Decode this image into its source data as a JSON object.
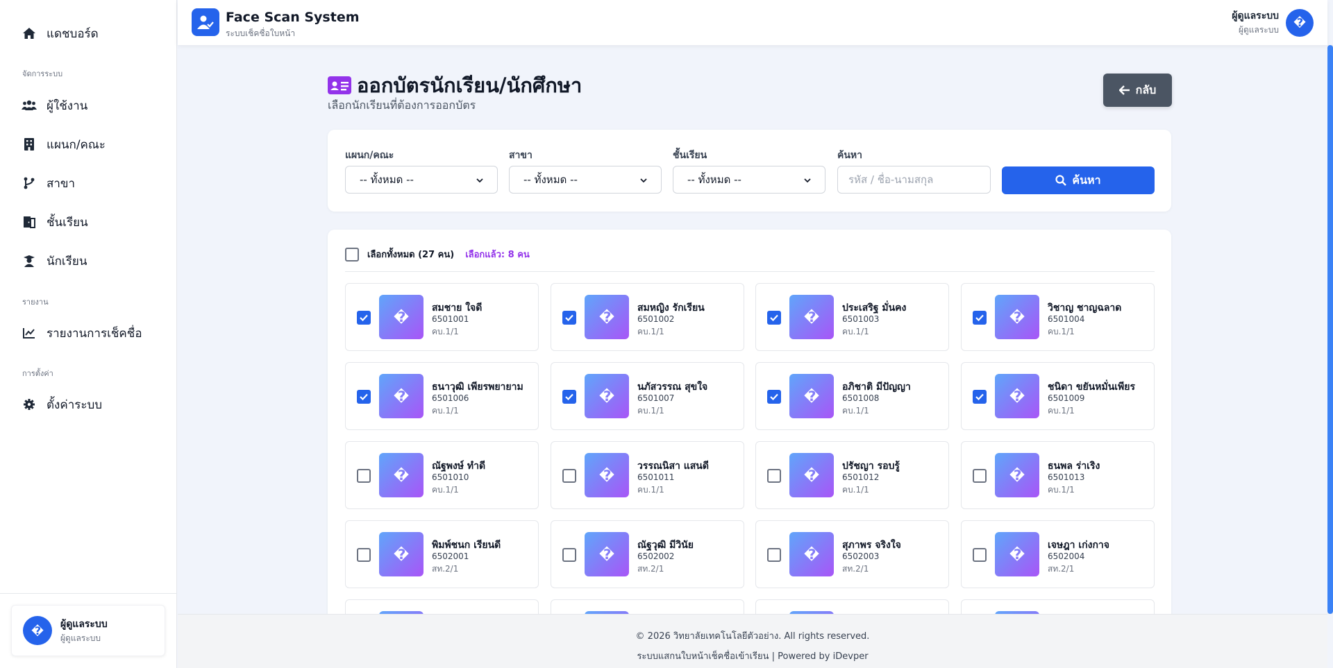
{
  "app": {
    "title": "Face Scan System",
    "subtitle": "ระบบเช็คชื่อใบหน้า",
    "brand_color": "#2563eb"
  },
  "sidebar": {
    "dashboard": "แดชบอร์ด",
    "section_manage": "จัดการระบบ",
    "users": "ผู้ใช้งาน",
    "departments": "แผนก/คณะ",
    "majors": "สาขา",
    "classes": "ชั้นเรียน",
    "students": "นักเรียน",
    "section_report": "รายงาน",
    "attendance_report": "รายงานการเช็คชื่อ",
    "section_settings": "การตั้งค่า",
    "settings": "ตั้งค่าระบบ",
    "user_name": "ผู้ดูแลระบบ",
    "user_role": "ผู้ดูแลระบบ",
    "avatar_glyph": "�"
  },
  "header": {
    "user_name": "ผู้ดูแลระบบ",
    "user_role": "ผู้ดูแลระบบ",
    "avatar_glyph": "�"
  },
  "page": {
    "title": "ออกบัตรนักเรียน/นักศึกษา",
    "subtitle": "เลือกนักเรียนที่ต้องการออกบัตร",
    "back_label": "กลับ"
  },
  "filters": {
    "department_label": "แผนก/คณะ",
    "department_value": "-- ทั้งหมด --",
    "major_label": "สาขา",
    "major_value": "-- ทั้งหมด --",
    "class_label": "ชั้นเรียน",
    "class_value": "-- ทั้งหมด --",
    "search_label": "ค้นหา",
    "search_placeholder": "รหัส / ชื่อ-นามสกุล",
    "search_button": "ค้นหา"
  },
  "selection": {
    "select_all_label": "เลือกทั้งหมด (27 คน)",
    "selected_count": "เลือกแล้ว: 8 คน"
  },
  "students": [
    {
      "name": "สมชาย ใจดี",
      "code": "6501001",
      "class": "คบ.1/1",
      "checked": true
    },
    {
      "name": "สมหญิง รักเรียน",
      "code": "6501002",
      "class": "คบ.1/1",
      "checked": true
    },
    {
      "name": "ประเสริฐ มั่นคง",
      "code": "6501003",
      "class": "คบ.1/1",
      "checked": true
    },
    {
      "name": "วิชาญ ชาญฉลาด",
      "code": "6501004",
      "class": "คบ.1/1",
      "checked": true
    },
    {
      "name": "ธนาวุฒิ เพียรพยายาม",
      "code": "6501006",
      "class": "คบ.1/1",
      "checked": true
    },
    {
      "name": "นภัสวรรณ สุขใจ",
      "code": "6501007",
      "class": "คบ.1/1",
      "checked": true
    },
    {
      "name": "อภิชาติ มีปัญญา",
      "code": "6501008",
      "class": "คบ.1/1",
      "checked": true
    },
    {
      "name": "ชนิดา ขยันหมั่นเพียร",
      "code": "6501009",
      "class": "คบ.1/1",
      "checked": true
    },
    {
      "name": "ณัฐพงษ์ ทำดี",
      "code": "6501010",
      "class": "คบ.1/1",
      "checked": false
    },
    {
      "name": "วรรณนิสา แสนดี",
      "code": "6501011",
      "class": "คบ.1/1",
      "checked": false
    },
    {
      "name": "ปรัชญา รอบรู้",
      "code": "6501012",
      "class": "คบ.1/1",
      "checked": false
    },
    {
      "name": "ธนพล ร่าเริง",
      "code": "6501013",
      "class": "คบ.1/1",
      "checked": false
    },
    {
      "name": "พิมพ์ชนก เรียนดี",
      "code": "6502001",
      "class": "สท.2/1",
      "checked": false
    },
    {
      "name": "ณัฐวุฒิ มีวินัย",
      "code": "6502002",
      "class": "สท.2/1",
      "checked": false
    },
    {
      "name": "สุภาพร จริงใจ",
      "code": "6502003",
      "class": "สท.2/1",
      "checked": false
    },
    {
      "name": "เจษฎา เก่งกาจ",
      "code": "6502004",
      "class": "สท.2/1",
      "checked": false
    }
  ],
  "photo_glyph": "�",
  "footer": {
    "copyright": "© 2026 วิทยาลัยเทคโนโลยีตัวอย่าง. All rights reserved.",
    "powered": "ระบบแสกนใบหน้าเช็คชื่อเข้าเรียน | Powered by iDevper"
  }
}
